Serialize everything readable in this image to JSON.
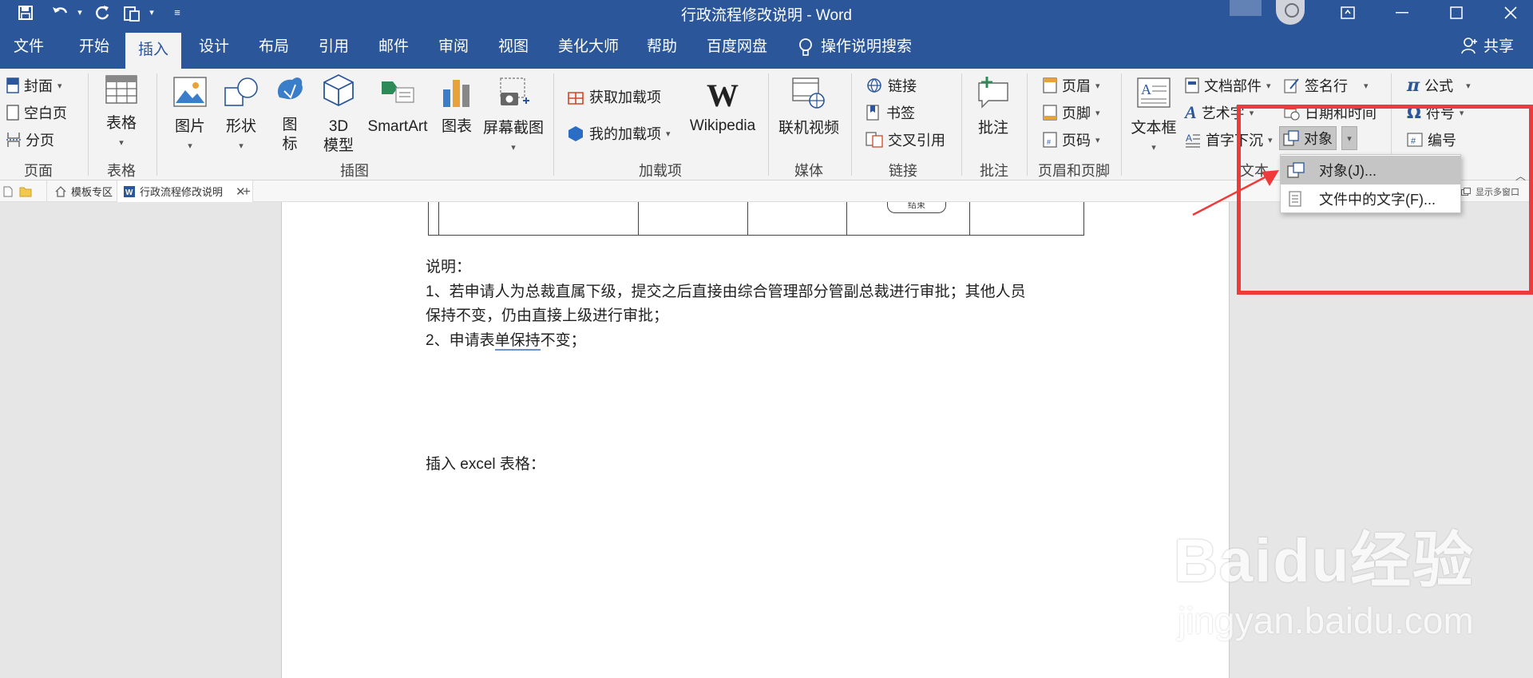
{
  "window": {
    "title": "行政流程修改说明  -  Word"
  },
  "quick_access": {
    "icons": [
      "save-icon",
      "undo-icon",
      "redo-icon",
      "clipboard-icon",
      "customize-icon"
    ]
  },
  "menu_tabs": [
    "文件",
    "开始",
    "插入",
    "设计",
    "布局",
    "引用",
    "邮件",
    "审阅",
    "视图",
    "美化大师",
    "帮助",
    "百度网盘"
  ],
  "active_tab": "插入",
  "tell_me": "操作说明搜索",
  "share": "共享",
  "ribbon": {
    "pages": {
      "label": "页面",
      "cover": "封面",
      "blank": "空白页",
      "break": "分页"
    },
    "tables": {
      "label": "表格",
      "table": "表格"
    },
    "illustrations": {
      "label": "插图",
      "picture": "图片",
      "shapes": "形状",
      "icons_1": "图",
      "icons_2": "标",
      "model_1": "3D",
      "model_2": "模型",
      "smartart": "SmartArt",
      "chart": "图表",
      "screenshot": "屏幕截图"
    },
    "addins": {
      "label": "加载项",
      "get": "获取加载项",
      "my": "我的加载项",
      "wikipedia": "Wikipedia"
    },
    "media": {
      "label": "媒体",
      "video": "联机视频"
    },
    "links": {
      "label": "链接",
      "link": "链接",
      "bookmark": "书签",
      "crossref": "交叉引用"
    },
    "comments": {
      "label": "批注",
      "comment": "批注"
    },
    "header_footer": {
      "label": "页眉和页脚",
      "header": "页眉",
      "footer": "页脚",
      "pagenum": "页码"
    },
    "text": {
      "label": "文本",
      "textbox": "文本框",
      "quickparts": "文档部件",
      "wordart": "艺术字",
      "dropcap": "首字下沉",
      "signature": "签名行",
      "datetime": "日期和时间",
      "object": "对象"
    },
    "symbols": {
      "equation": "公式",
      "symbol": "符号",
      "number": "编号"
    }
  },
  "doc_tabs": {
    "templates": "模板专区",
    "current": "行政流程修改说明",
    "show_multi": "显示多窗口"
  },
  "document": {
    "end_node": "结束",
    "note_title": "说明：",
    "note_1a": "1、若申请人为总裁直属下级，提交之后直接由综合管理部分管副总裁进行审批；其他人员",
    "note_1b": "保持不变，仍由直接上级进行审批；",
    "note_2_pre": "2、申请表",
    "note_2_mid": "单保持",
    "note_2_post": "不变；",
    "insert_excel": "插入 excel 表格："
  },
  "object_menu": {
    "item_1": "对象(J)...",
    "item_2": "文件中的文字(F)..."
  },
  "watermark": {
    "brand": "Baidu经验",
    "url": "jingyan.baidu.com"
  },
  "colors": {
    "word_blue": "#2b579a",
    "ribbon_bg": "#f3f3f3",
    "annotation_red": "#f03a3a"
  }
}
